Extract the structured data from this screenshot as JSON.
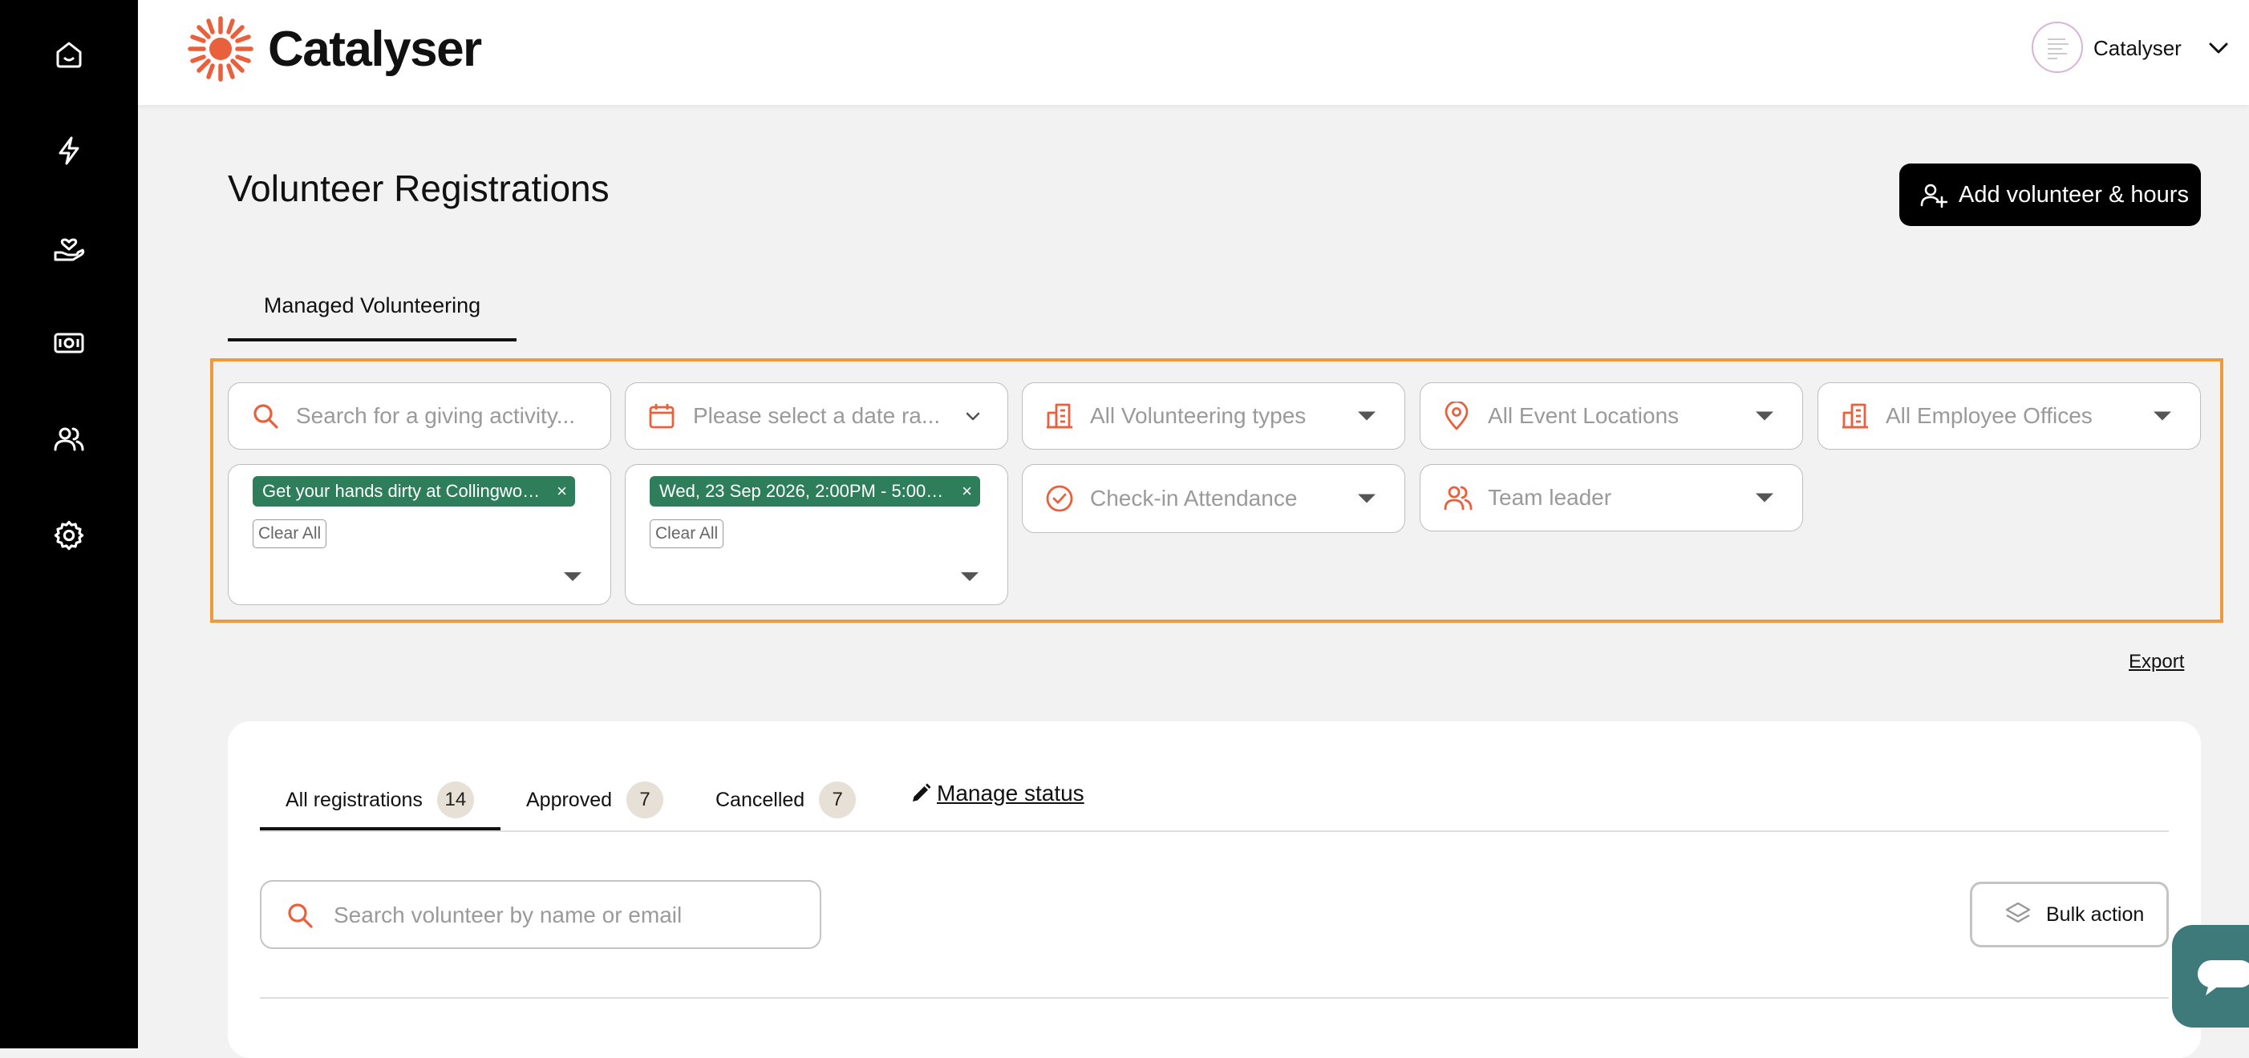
{
  "brand": {
    "name": "Catalyser",
    "accent": "#e8603c"
  },
  "sidebar": {
    "items": [
      {
        "icon": "home-icon"
      },
      {
        "icon": "lightning-icon"
      },
      {
        "icon": "hand-heart-icon"
      },
      {
        "icon": "money-icon"
      },
      {
        "icon": "users-icon"
      },
      {
        "icon": "gear-icon"
      }
    ]
  },
  "user": {
    "name": "Catalyser"
  },
  "page": {
    "title": "Volunteer Registrations",
    "add_button": "Add volunteer & hours"
  },
  "tabs": [
    {
      "label": "Managed Volunteering"
    }
  ],
  "filters": {
    "search_placeholder": "Search for a giving activity...",
    "date_placeholder": "Please select a date ra...",
    "types": "All Volunteering types",
    "locations": "All Event Locations",
    "offices": "All Employee Offices",
    "activity_chip": "Get your hands dirty at Collingwoo...",
    "date_chip": "Wed, 23 Sep 2026, 2:00PM - 5:00P...",
    "clear_all": "Clear All",
    "attendance": "Check-in Attendance",
    "team_leader": "Team leader"
  },
  "export": "Export",
  "status_tabs": [
    {
      "label": "All registrations",
      "count": "14"
    },
    {
      "label": "Approved",
      "count": "7"
    },
    {
      "label": "Cancelled",
      "count": "7"
    }
  ],
  "manage_status": "Manage status",
  "volunteer_search": {
    "placeholder": "Search volunteer by name or email"
  },
  "bulk_action": "Bulk action",
  "colors": {
    "chip_green": "#2e7d5b",
    "filter_highlight": "#f0993a",
    "chat": "#3f7a7b"
  }
}
